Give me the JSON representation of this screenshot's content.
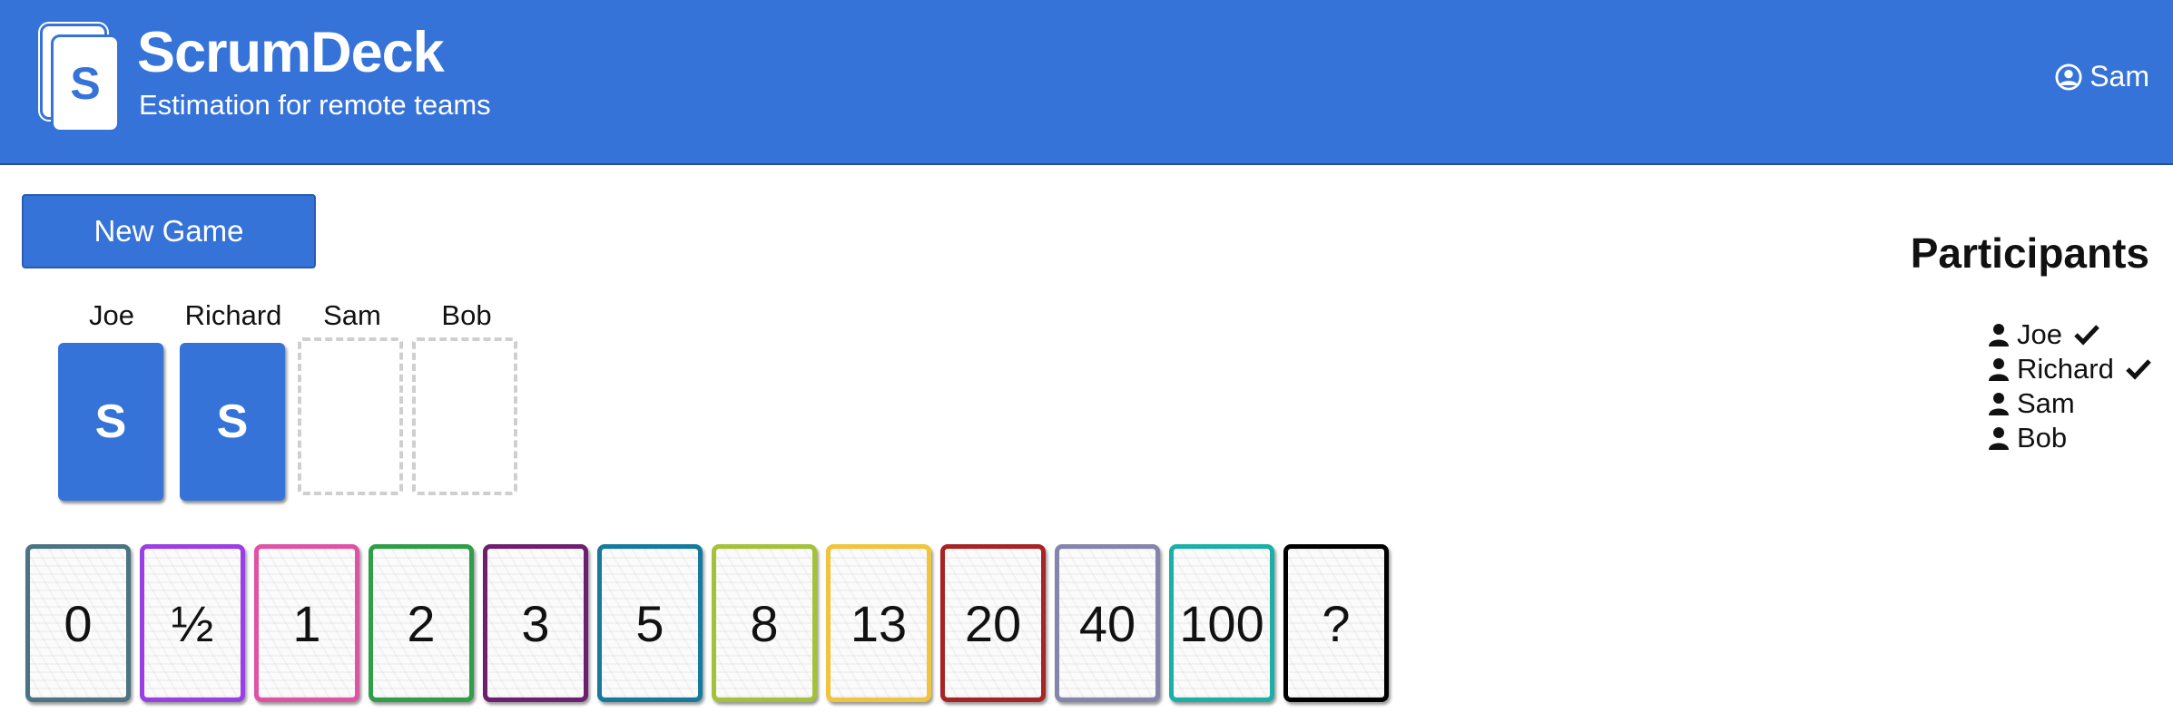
{
  "header": {
    "logo_letter": "S",
    "title": "ScrumDeck",
    "subtitle": "Estimation for remote teams",
    "user_name": "Sam",
    "bg_color": "#3673d9"
  },
  "actions": {
    "new_game_label": "New Game"
  },
  "table": {
    "seats": [
      {
        "name": "Joe",
        "card": "S",
        "state": "played"
      },
      {
        "name": "Richard",
        "card": "S",
        "state": "played"
      },
      {
        "name": "Sam",
        "card": "",
        "state": "empty"
      },
      {
        "name": "Bob",
        "card": "",
        "state": "empty"
      }
    ]
  },
  "participants": {
    "title": "Participants",
    "list": [
      {
        "name": "Joe",
        "voted": true
      },
      {
        "name": "Richard",
        "voted": true
      },
      {
        "name": "Sam",
        "voted": false
      },
      {
        "name": "Bob",
        "voted": false
      }
    ]
  },
  "hand": {
    "cards": [
      {
        "value": "0",
        "color": "#4b7383"
      },
      {
        "value": "½",
        "color": "#9a3ee6"
      },
      {
        "value": "1",
        "color": "#e052a4"
      },
      {
        "value": "2",
        "color": "#2e9e48"
      },
      {
        "value": "3",
        "color": "#6e1f70"
      },
      {
        "value": "5",
        "color": "#157a9e"
      },
      {
        "value": "8",
        "color": "#a3c23a"
      },
      {
        "value": "13",
        "color": "#f0c43c"
      },
      {
        "value": "20",
        "color": "#a82424"
      },
      {
        "value": "40",
        "color": "#8484ad"
      },
      {
        "value": "100",
        "color": "#1ab0a8"
      },
      {
        "value": "?",
        "color": "#000000"
      }
    ]
  },
  "icons": {
    "user_menu": "user-circle-icon",
    "participant": "user-icon",
    "voted": "check-icon"
  }
}
